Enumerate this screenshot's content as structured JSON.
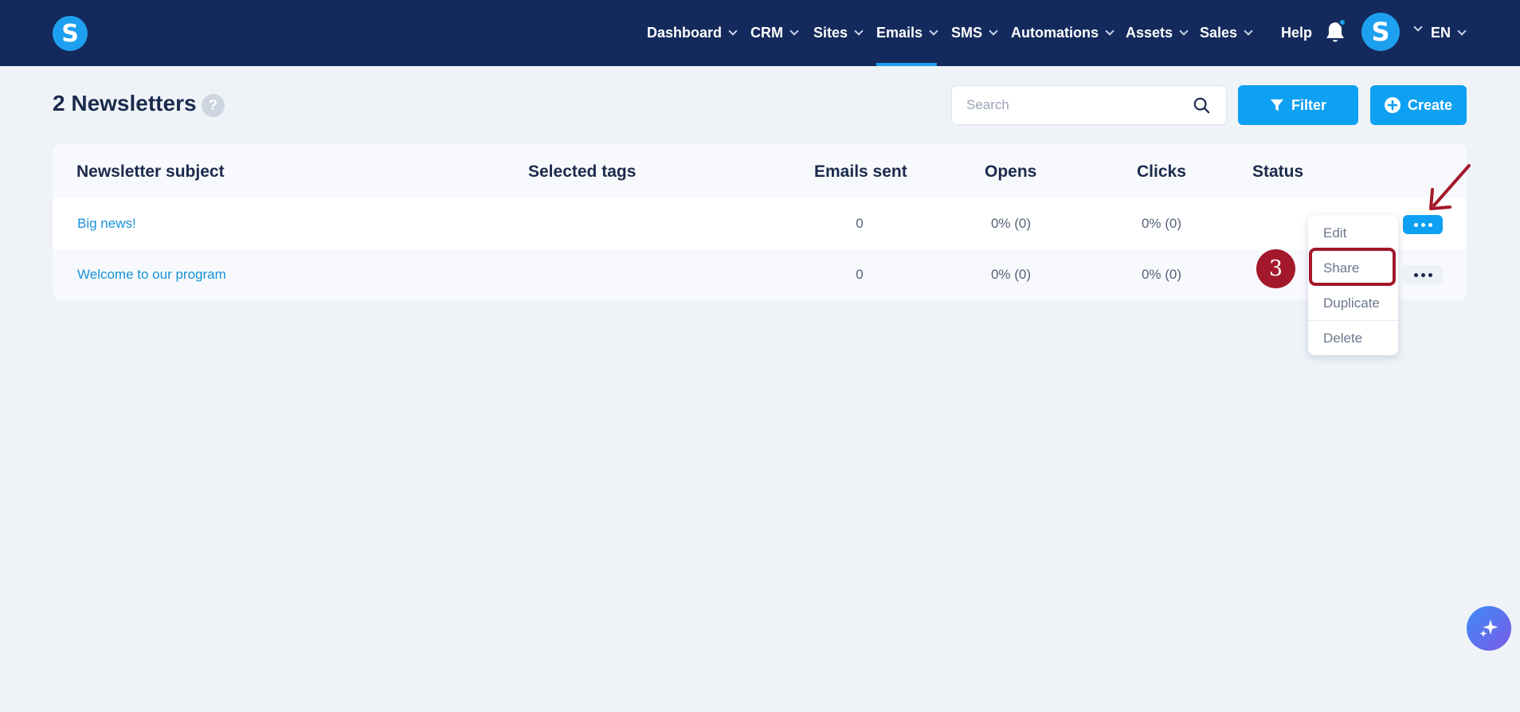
{
  "app": {
    "logo_letter": "S",
    "brand_color": "#142a5c",
    "accent_color": "#0ea0f2"
  },
  "nav": {
    "items": [
      {
        "label": "Dashboard"
      },
      {
        "label": "CRM"
      },
      {
        "label": "Sites"
      },
      {
        "label": "Emails",
        "active": true
      },
      {
        "label": "SMS"
      },
      {
        "label": "Automations"
      },
      {
        "label": "Assets"
      },
      {
        "label": "Sales"
      }
    ],
    "help": "Help",
    "avatar_letter": "S",
    "language": "EN",
    "notification_icon": "bell-icon"
  },
  "page": {
    "title": "2 Newsletters",
    "help_badge": "?",
    "search_placeholder": "Search",
    "filter_label": "Filter",
    "create_label": "Create"
  },
  "table": {
    "headers": {
      "subject": "Newsletter subject",
      "tags": "Selected tags",
      "emails_sent": "Emails sent",
      "opens": "Opens",
      "clicks": "Clicks",
      "status": "Status"
    },
    "rows": [
      {
        "subject": "Big news!",
        "tags": "",
        "emails_sent": "0",
        "opens": "0% (0)",
        "clicks": "0% (0)",
        "status": ""
      },
      {
        "subject": "Welcome to our program",
        "tags": "",
        "emails_sent": "0",
        "opens": "0% (0)",
        "clicks": "0% (0)",
        "status": ""
      }
    ]
  },
  "row_menu": {
    "items": [
      "Edit",
      "Share",
      "Duplicate",
      "Delete"
    ],
    "highlighted": "Share"
  },
  "annotation": {
    "step_number": "3",
    "color": "#a3182a"
  }
}
